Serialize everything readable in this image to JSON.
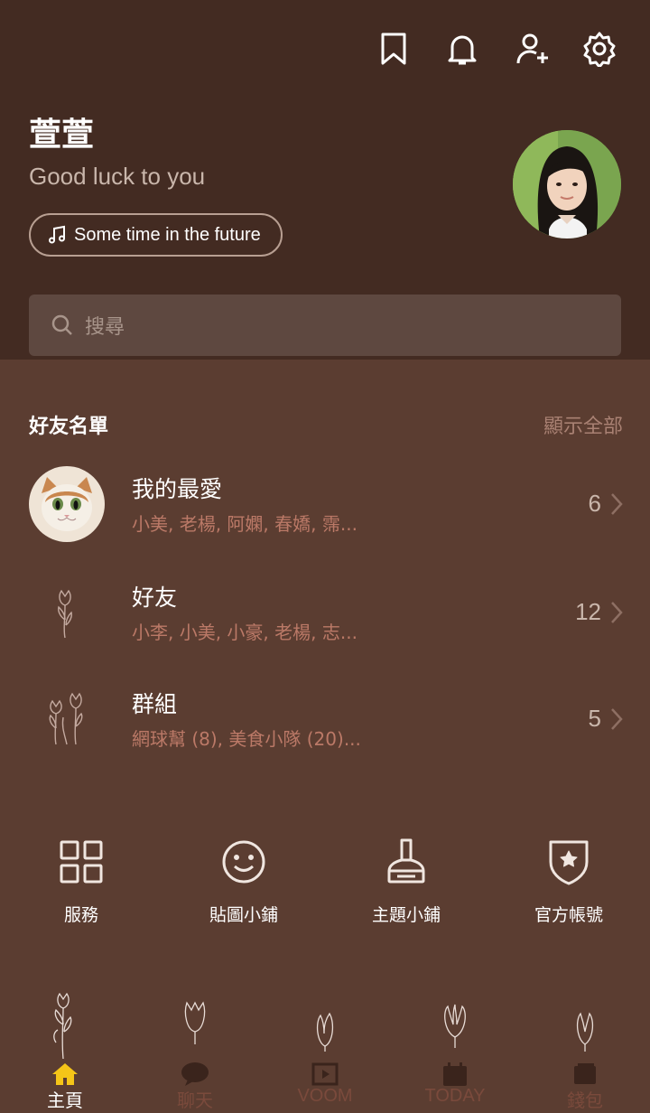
{
  "header": {
    "icons": [
      "bookmark-icon",
      "bell-icon",
      "add-friend-icon",
      "gear-icon"
    ]
  },
  "profile": {
    "name": "萱萱",
    "status_message": "Good luck to you",
    "music": "Some time in the future"
  },
  "search": {
    "placeholder": "搜尋"
  },
  "friends_section": {
    "title": "好友名單",
    "show_all": "顯示全部",
    "rows": [
      {
        "title": "我的最愛",
        "subtitle": "小美, 老楊, 阿嫻, 春嬌, 霈...",
        "count": "6"
      },
      {
        "title": "好友",
        "subtitle": "小李, 小美, 小豪, 老楊, 志...",
        "count": "12"
      },
      {
        "title": "群組",
        "subtitle": "網球幫 (8), 美食小隊 (20)...",
        "count": "5"
      }
    ]
  },
  "shortcuts": [
    {
      "label": "服務",
      "icon": "grid-icon"
    },
    {
      "label": "貼圖小鋪",
      "icon": "smiley-icon"
    },
    {
      "label": "主題小鋪",
      "icon": "brush-icon"
    },
    {
      "label": "官方帳號",
      "icon": "shield-star-icon"
    }
  ],
  "tabs": [
    {
      "label": "主頁",
      "icon": "home-icon",
      "active": true
    },
    {
      "label": "聊天",
      "icon": "chat-icon",
      "active": false
    },
    {
      "label": "VOOM",
      "icon": "video-icon",
      "active": false
    },
    {
      "label": "TODAY",
      "icon": "calendar-icon",
      "active": false
    },
    {
      "label": "錢包",
      "icon": "wallet-icon",
      "active": false
    }
  ],
  "colors": {
    "header_bg": "#432b22",
    "body_bg": "#5b3d31",
    "accent_yellow": "#f5c518",
    "subtitle": "#bb7967"
  }
}
